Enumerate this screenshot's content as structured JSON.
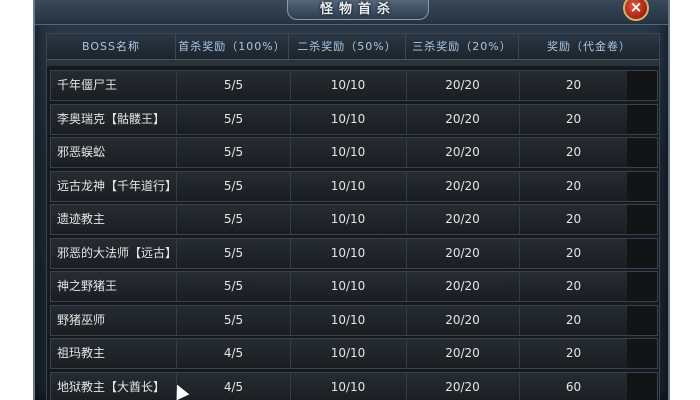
{
  "window": {
    "title": "怪物首杀",
    "close_label": "×"
  },
  "table": {
    "headers": [
      "BOSS名称",
      "首杀奖励（100%）",
      "二杀奖励（50%）",
      "三杀奖励（20%）",
      "奖励（代金卷）"
    ],
    "rows": [
      {
        "name": "千年僵尸王",
        "first": "5/5",
        "second": "10/10",
        "third": "20/20",
        "reward": "20"
      },
      {
        "name": "李奥瑞克【骷髅王】",
        "first": "5/5",
        "second": "10/10",
        "third": "20/20",
        "reward": "20"
      },
      {
        "name": "邪恶蜈蚣",
        "first": "5/5",
        "second": "10/10",
        "third": "20/20",
        "reward": "20"
      },
      {
        "name": "远古龙神【千年道行】",
        "first": "5/5",
        "second": "10/10",
        "third": "20/20",
        "reward": "20"
      },
      {
        "name": "遗迹教主",
        "first": "5/5",
        "second": "10/10",
        "third": "20/20",
        "reward": "20"
      },
      {
        "name": "邪恶的大法师【远古】",
        "first": "5/5",
        "second": "10/10",
        "third": "20/20",
        "reward": "20"
      },
      {
        "name": "神之野猪王",
        "first": "5/5",
        "second": "10/10",
        "third": "20/20",
        "reward": "20"
      },
      {
        "name": "野猪巫师",
        "first": "5/5",
        "second": "10/10",
        "third": "20/20",
        "reward": "20"
      },
      {
        "name": "祖玛教主",
        "first": "4/5",
        "second": "10/10",
        "third": "20/20",
        "reward": "20"
      },
      {
        "name": "地狱教主【大酋长】",
        "first": "4/5",
        "second": "10/10",
        "third": "20/20",
        "reward": "60"
      }
    ]
  },
  "colors": {
    "header_text": "#a8c8e8",
    "cell_text": "#e4e4e4",
    "close_bg": "#c03020"
  }
}
